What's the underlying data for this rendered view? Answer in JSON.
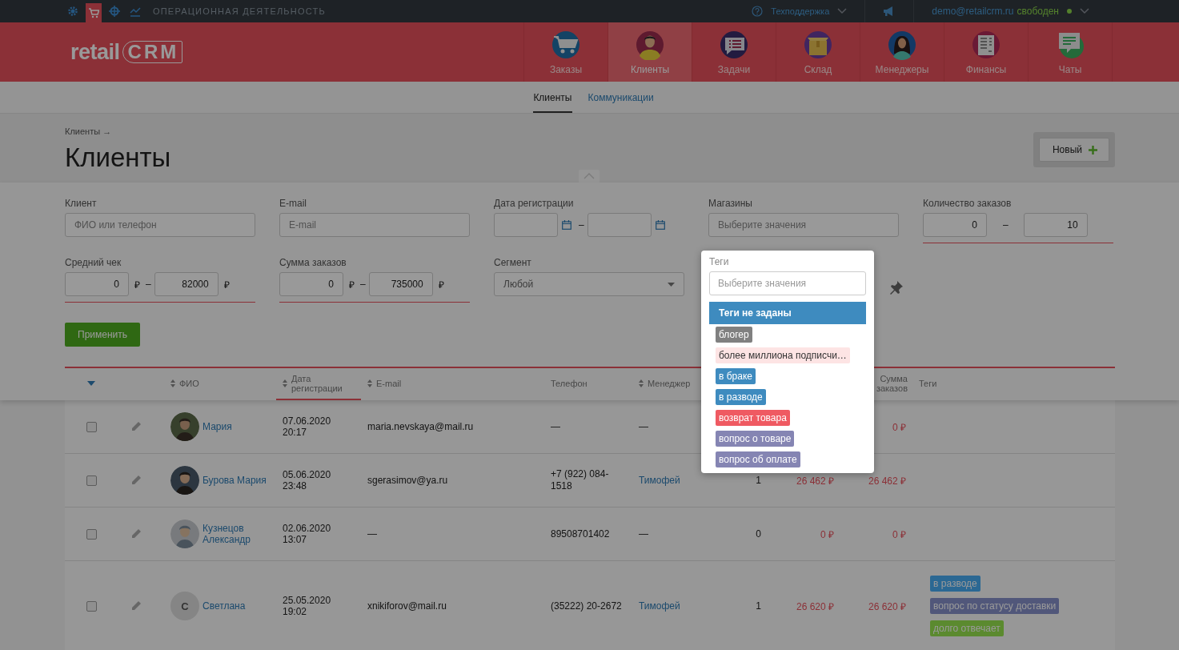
{
  "topbar": {
    "icons": [
      {
        "kind": "gear",
        "selected": false
      },
      {
        "kind": "cart",
        "selected": true
      },
      {
        "kind": "target",
        "selected": false
      },
      {
        "kind": "chart",
        "selected": false
      }
    ],
    "section": "ОПЕРАЦИОННАЯ ДЕЯТЕЛЬНОСТЬ",
    "support": "Техподдержка",
    "user_email": "demo@retailcrm.ru",
    "user_status": "свободен"
  },
  "logo": {
    "text": "retail",
    "boxed": "CRM"
  },
  "nav": [
    {
      "label": "Заказы",
      "selected": false
    },
    {
      "label": "Клиенты",
      "selected": true
    },
    {
      "label": "Задачи",
      "selected": false
    },
    {
      "label": "Склад",
      "selected": false
    },
    {
      "label": "Менеджеры",
      "selected": false
    },
    {
      "label": "Финансы",
      "selected": false
    },
    {
      "label": "Чаты",
      "selected": false
    }
  ],
  "subnav": [
    {
      "label": "Клиенты",
      "selected": true
    },
    {
      "label": "Коммуникации",
      "selected": false
    }
  ],
  "breadcrumb": "Клиенты →",
  "title": "Клиенты",
  "new_button": "Новый",
  "filters": [
    {
      "kind": "text",
      "label": "Клиент",
      "placeholder": "ФИО или телефон",
      "active": false
    },
    {
      "kind": "text",
      "label": "E-mail",
      "placeholder": "E-mail",
      "active": false
    },
    {
      "kind": "date_range",
      "label": "Дата регистрации",
      "separator": "–",
      "active": false
    },
    {
      "kind": "multiselect",
      "label": "Магазины",
      "placeholder": "Выберите значения",
      "active": false
    },
    {
      "kind": "range",
      "label": "Количество заказов",
      "from": "0",
      "to": "10",
      "separator": "–",
      "active": true
    },
    {
      "kind": "range",
      "label": "Средний чек",
      "from": "0",
      "to": "82000",
      "currency": "₽",
      "separator": "–",
      "active": true
    },
    {
      "kind": "range",
      "label": "Сумма заказов",
      "from": "0",
      "to": "735000",
      "currency": "₽",
      "separator": "–",
      "active": true
    },
    {
      "kind": "select",
      "label": "Сегмент",
      "value": "Любой",
      "active": false
    },
    {
      "kind": "tags_slot"
    }
  ],
  "apply_button": "Применить",
  "tag_filter": {
    "label": "Теги",
    "placeholder": "Выберите значения",
    "options": [
      {
        "kind": "none",
        "label": "Теги не заданы",
        "selected": true
      },
      {
        "kind": "tag",
        "label": "блогер",
        "color": "#808080",
        "selected": false
      },
      {
        "kind": "tag",
        "label": "более миллиона подписчи…",
        "color": "#fde4e4",
        "selected": false
      },
      {
        "kind": "tag",
        "label": "в браке",
        "color": "#3e8bbf",
        "selected": false
      },
      {
        "kind": "tag",
        "label": "в разводе",
        "color": "#3e8bbf",
        "selected": false
      },
      {
        "kind": "tag",
        "label": "возврат товара",
        "color": "#ef5a62",
        "selected": false
      },
      {
        "kind": "tag",
        "label": "вопрос о товаре",
        "color": "#8585b3",
        "selected": false
      },
      {
        "kind": "tag",
        "label": "вопрос об оплате",
        "color": "#8585b3",
        "selected": false
      }
    ]
  },
  "table": {
    "columns": [
      {
        "kind": "toggle"
      },
      {
        "kind": "edit"
      },
      {
        "kind": "name",
        "label": "ФИО",
        "sortable": true,
        "sorted": false
      },
      {
        "kind": "date",
        "label": "Дата регистрации",
        "sortable": true,
        "sorted": true
      },
      {
        "kind": "email",
        "label": "E-mail",
        "sortable": true,
        "sorted": false
      },
      {
        "kind": "phone",
        "label": "Телефон",
        "sorted": false
      },
      {
        "kind": "manager",
        "label": "Менеджер",
        "sortable": true,
        "sorted": false
      },
      {
        "kind": "orders"
      },
      {
        "kind": "avg"
      },
      {
        "kind": "total",
        "label": "Сумма заказов",
        "sorted": false
      },
      {
        "kind": "tags",
        "label": "Теги",
        "sorted": false
      }
    ],
    "rows": [
      {
        "checked": false,
        "name": "Мария",
        "date": "07.06.2020",
        "time": "20:17",
        "email": "maria.nevskaya@mail.ru",
        "phone": "—",
        "manager": "—",
        "manager_assigned": false,
        "total": "0 ₽",
        "tags": []
      },
      {
        "checked": false,
        "name": "Бурова Мария",
        "date": "05.06.2020",
        "time": "23:48",
        "email": "sgerasimov@ya.ru",
        "phone": "+7 (922) 084-1518",
        "manager": "Тимофей",
        "manager_assigned": true,
        "orders": "1",
        "avg": "26 462 ₽",
        "total": "26 462 ₽",
        "tags": []
      },
      {
        "checked": false,
        "name": "Кузнецов Александр",
        "date": "02.06.2020",
        "time": "13:07",
        "email": "—",
        "phone": "89508701402",
        "manager": "—",
        "manager_assigned": false,
        "orders": "0",
        "avg": "0 ₽",
        "total": "0 ₽",
        "tags": []
      },
      {
        "checked": false,
        "initial": "С",
        "name": "Светлана",
        "date": "25.05.2020",
        "time": "19:02",
        "email": "xnikiforov@mail.ru",
        "phone": "(35222) 20-2672",
        "manager": "Тимофей",
        "manager_assigned": true,
        "orders": "1",
        "avg": "26 620 ₽",
        "total": "26 620 ₽",
        "tags": [
          {
            "label": "в разводе",
            "color": "#2b6893"
          },
          {
            "label": "вопрос по статусу доставки",
            "color": "#51577a"
          },
          {
            "label": "долго отвечает",
            "color": "#5b8a2f"
          }
        ]
      }
    ]
  }
}
